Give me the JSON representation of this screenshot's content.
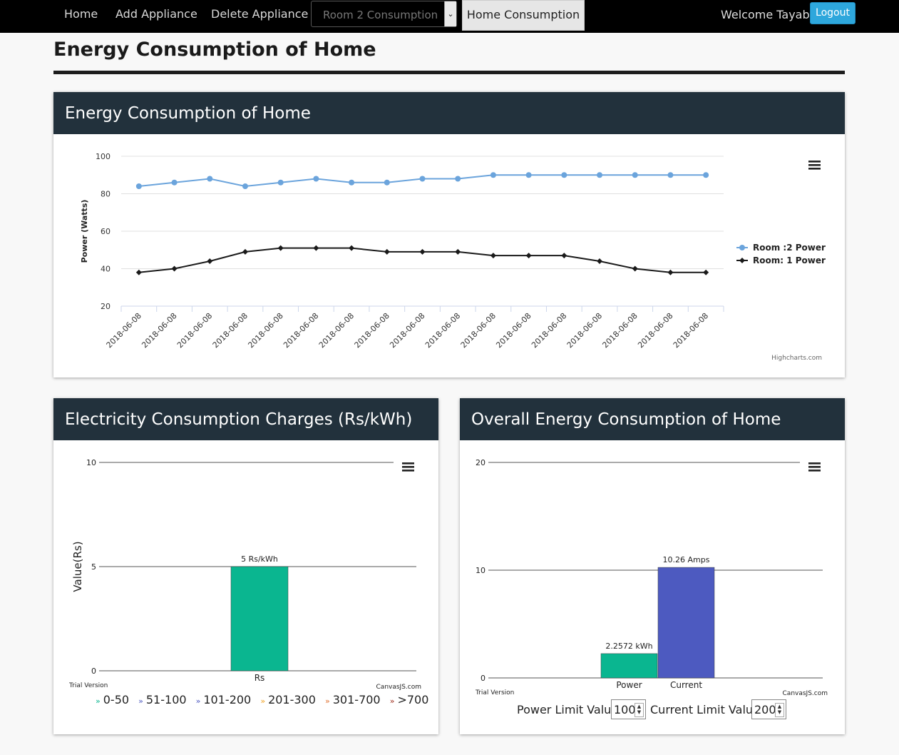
{
  "nav": {
    "home": "Home",
    "add_appliance": "Add Appliance",
    "delete_appliance": "Delete Appliance",
    "room_select": "Room 2 Consumption",
    "home_consumption": "Home Consumption",
    "welcome": "Welcome Tayab",
    "logout": "Logout"
  },
  "page_title": "Energy Consumption of Home",
  "panels": {
    "main": "Energy Consumption of Home",
    "charges": "Electricity Consumption Charges (Rs/kWh)",
    "overall": "Overall Energy Consumption of Home"
  },
  "colors": {
    "room2": "#6ba4dc",
    "room1": "#1a1a1a",
    "teal": "#0ab690",
    "blue": "#4d5ac0",
    "header": "#22313c"
  },
  "chart_data": [
    {
      "type": "line",
      "title": "",
      "xlabel": "",
      "ylabel": "Power (Watts)",
      "ylim": [
        20,
        100
      ],
      "yticks": [
        20,
        40,
        60,
        80,
        100
      ],
      "grid": true,
      "legend": "right",
      "credit": "Highcharts.com",
      "categories": [
        "2018-06-08",
        "2018-06-08",
        "2018-06-08",
        "2018-06-08",
        "2018-06-08",
        "2018-06-08",
        "2018-06-08",
        "2018-06-08",
        "2018-06-08",
        "2018-06-08",
        "2018-06-08",
        "2018-06-08",
        "2018-06-08",
        "2018-06-08",
        "2018-06-08",
        "2018-06-08",
        "2018-06-08"
      ],
      "series": [
        {
          "name": "Room :2 Power",
          "values": [
            84,
            86,
            88,
            84,
            86,
            88,
            86,
            86,
            88,
            88,
            90,
            90,
            90,
            90,
            90,
            90,
            90
          ]
        },
        {
          "name": "Room: 1 Power",
          "values": [
            38,
            40,
            44,
            49,
            51,
            51,
            51,
            49,
            49,
            49,
            47,
            47,
            47,
            44,
            40,
            38,
            38
          ]
        }
      ]
    },
    {
      "type": "bar",
      "title": "",
      "xlabel": "",
      "ylabel": "Value(Rs)",
      "ylim": [
        0,
        10
      ],
      "yticks": [
        0,
        5,
        10
      ],
      "categories": [
        "Rs"
      ],
      "values": [
        5
      ],
      "data_labels": [
        "5 Rs/kWh"
      ],
      "watermark": "Trial Version",
      "credit": "CanvasJS.com",
      "legend_items": [
        "0-50",
        "51-100",
        "101-200",
        "201-300",
        "301-700",
        ">700"
      ],
      "legend_colors": [
        "#0ab690",
        "#4d5ac0",
        "#4d5ac0",
        "#f0a020",
        "#e07030",
        "#a03020"
      ]
    },
    {
      "type": "bar",
      "title": "",
      "xlabel": "",
      "ylabel": "",
      "ylim": [
        0,
        20
      ],
      "yticks": [
        0,
        10,
        20
      ],
      "categories": [
        "Power",
        "Current"
      ],
      "values": [
        2.2572,
        10.26
      ],
      "data_labels": [
        "2.2572 kWh",
        "10.26 Amps"
      ],
      "watermark": "Trial Version",
      "credit": "CanvasJS.com"
    }
  ],
  "limits": {
    "power_label": "Power Limit Value:",
    "power_value": "100",
    "current_label": "Current Limit Value:",
    "current_value": "200"
  }
}
